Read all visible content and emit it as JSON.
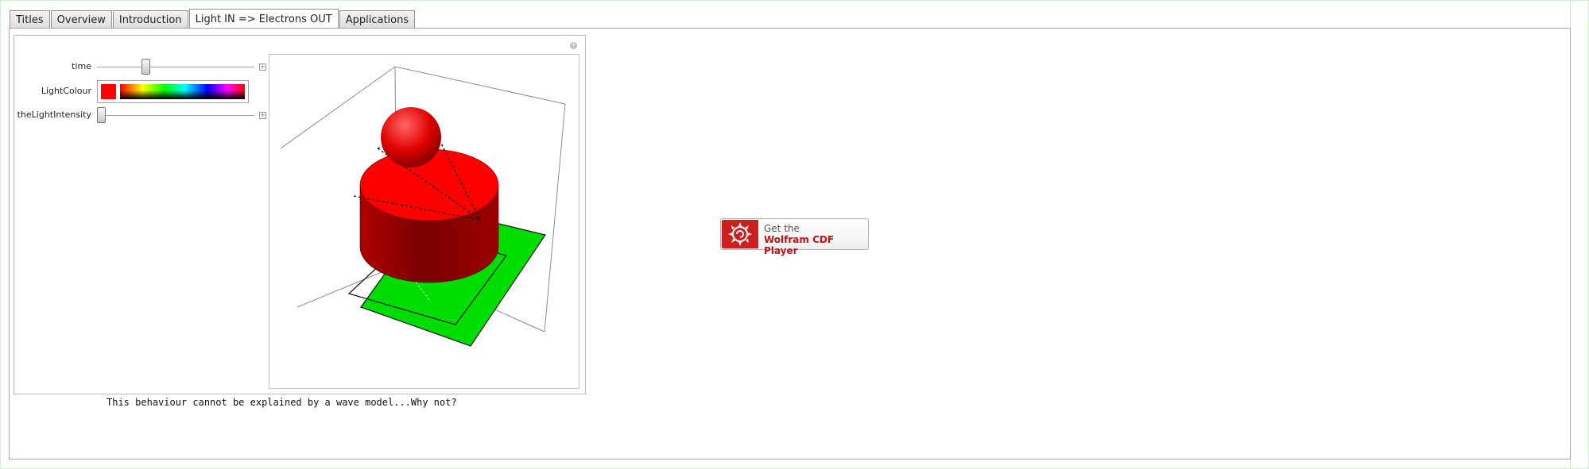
{
  "tabs": [
    {
      "label": "Titles"
    },
    {
      "label": "Overview"
    },
    {
      "label": "Introduction"
    },
    {
      "label": "Light IN => Electrons OUT",
      "active": true
    },
    {
      "label": "Applications"
    }
  ],
  "controls": {
    "time": {
      "label": "time",
      "value_fraction": 0.3
    },
    "light_colour": {
      "label": "LightColour",
      "value": "#ff0000"
    },
    "light_intensity": {
      "label": "theLightIntensity",
      "value_fraction": 0.0
    }
  },
  "caption": "This behaviour cannot be explained by a wave model...Why not?",
  "cdf_button": {
    "line1": "Get the",
    "line2": "Wolfram CDF Player"
  },
  "colors": {
    "object": "#ff0000",
    "plate": "#00dd00",
    "brand": "#cc1f1f"
  }
}
